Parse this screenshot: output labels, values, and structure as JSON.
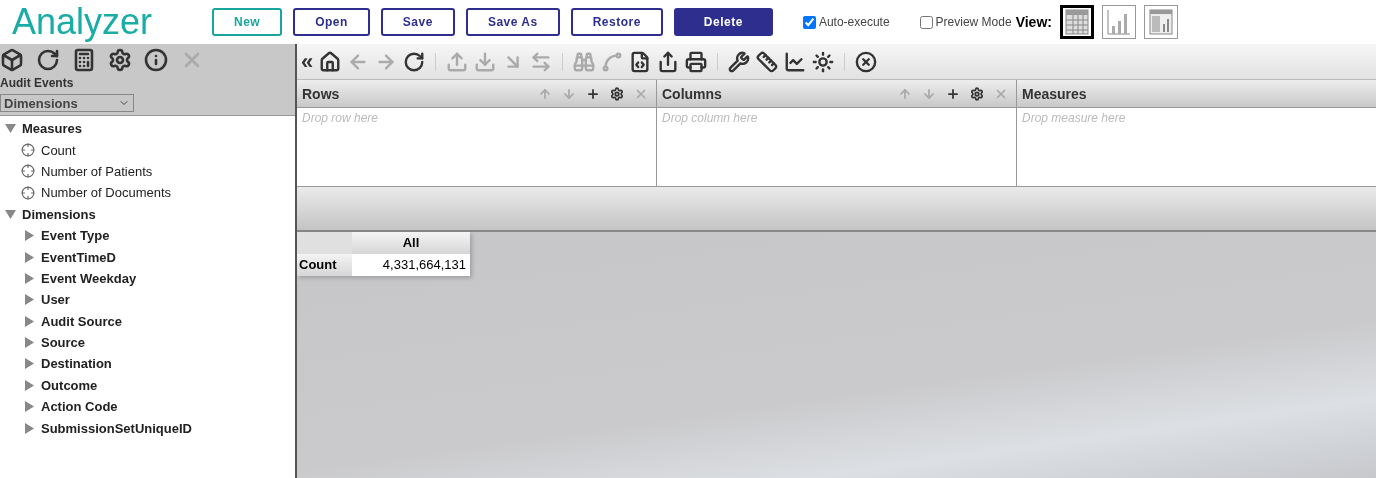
{
  "app_title": "Analyzer",
  "buttons": [
    {
      "label": "New",
      "kind": "accent"
    },
    {
      "label": "Open",
      "kind": "outline"
    },
    {
      "label": "Save",
      "kind": "outline"
    },
    {
      "label": "Save As",
      "kind": "outline"
    },
    {
      "label": "Restore",
      "kind": "outline"
    },
    {
      "label": "Delete",
      "kind": "primary"
    }
  ],
  "options": [
    {
      "label": "Auto-execute",
      "checked": true
    },
    {
      "label": "Preview Mode",
      "checked": false
    }
  ],
  "view": {
    "label": "View:",
    "modes": [
      {
        "selected": true
      },
      {
        "selected": false
      },
      {
        "selected": false
      }
    ]
  },
  "sidebar": {
    "tools": [
      {
        "disabled": false
      },
      {
        "disabled": false
      },
      {
        "disabled": false
      },
      {
        "disabled": false
      },
      {
        "disabled": false
      },
      {
        "disabled": true
      }
    ],
    "cube_name": "Audit Events",
    "select_value": "Dimensions",
    "tree": [
      {
        "label": "Measures",
        "expanded": true,
        "children": [
          {
            "label": "Count",
            "kind": "measure"
          },
          {
            "label": "Number of Patients",
            "kind": "measure"
          },
          {
            "label": "Number of Documents",
            "kind": "measure"
          }
        ]
      },
      {
        "label": "Dimensions",
        "expanded": true,
        "children": [
          {
            "label": "Event Type",
            "kind": "dimension",
            "expanded": false
          },
          {
            "label": "EventTimeD",
            "kind": "dimension",
            "expanded": false
          },
          {
            "label": "Event Weekday",
            "kind": "dimension",
            "expanded": false
          },
          {
            "label": "User",
            "kind": "dimension",
            "expanded": false
          },
          {
            "label": "Audit Source",
            "kind": "dimension",
            "expanded": false
          },
          {
            "label": "Source",
            "kind": "dimension",
            "expanded": false
          },
          {
            "label": "Destination",
            "kind": "dimension",
            "expanded": false
          },
          {
            "label": "Outcome",
            "kind": "dimension",
            "expanded": false
          },
          {
            "label": "Action Code",
            "kind": "dimension",
            "expanded": false
          },
          {
            "label": "SubmissionSetUniqueID",
            "kind": "dimension",
            "expanded": false
          }
        ]
      }
    ]
  },
  "toolbar": {
    "collapse": "«",
    "groups": [
      {
        "icons": [
          {
            "disabled": false
          },
          {
            "disabled": true
          },
          {
            "disabled": true
          },
          {
            "disabled": false
          }
        ]
      },
      {
        "icons": [
          {
            "disabled": true
          },
          {
            "disabled": true
          },
          {
            "disabled": true
          },
          {
            "disabled": true
          }
        ]
      },
      {
        "icons": [
          {
            "disabled": true
          },
          {
            "disabled": true
          },
          {
            "disabled": false
          },
          {
            "disabled": false
          },
          {
            "disabled": false
          }
        ]
      },
      {
        "icons": [
          {
            "disabled": false
          },
          {
            "disabled": false
          },
          {
            "disabled": false
          },
          {
            "disabled": false
          }
        ]
      },
      {
        "icons": [
          {
            "disabled": false
          }
        ]
      }
    ]
  },
  "drop_zones": [
    {
      "title": "Rows",
      "placeholder": "Drop row here",
      "tools": [
        {
          "disabled": true
        },
        {
          "disabled": true
        },
        {
          "disabled": false
        },
        {
          "disabled": false
        },
        {
          "disabled": true
        }
      ]
    },
    {
      "title": "Columns",
      "placeholder": "Drop column here",
      "tools": [
        {
          "disabled": true
        },
        {
          "disabled": true
        },
        {
          "disabled": false
        },
        {
          "disabled": false
        },
        {
          "disabled": true
        }
      ]
    },
    {
      "title": "Measures",
      "placeholder": "Drop measure here"
    }
  ],
  "pivot": {
    "column_header": "All",
    "row_header": "Count",
    "value": "4,331,664,131"
  }
}
